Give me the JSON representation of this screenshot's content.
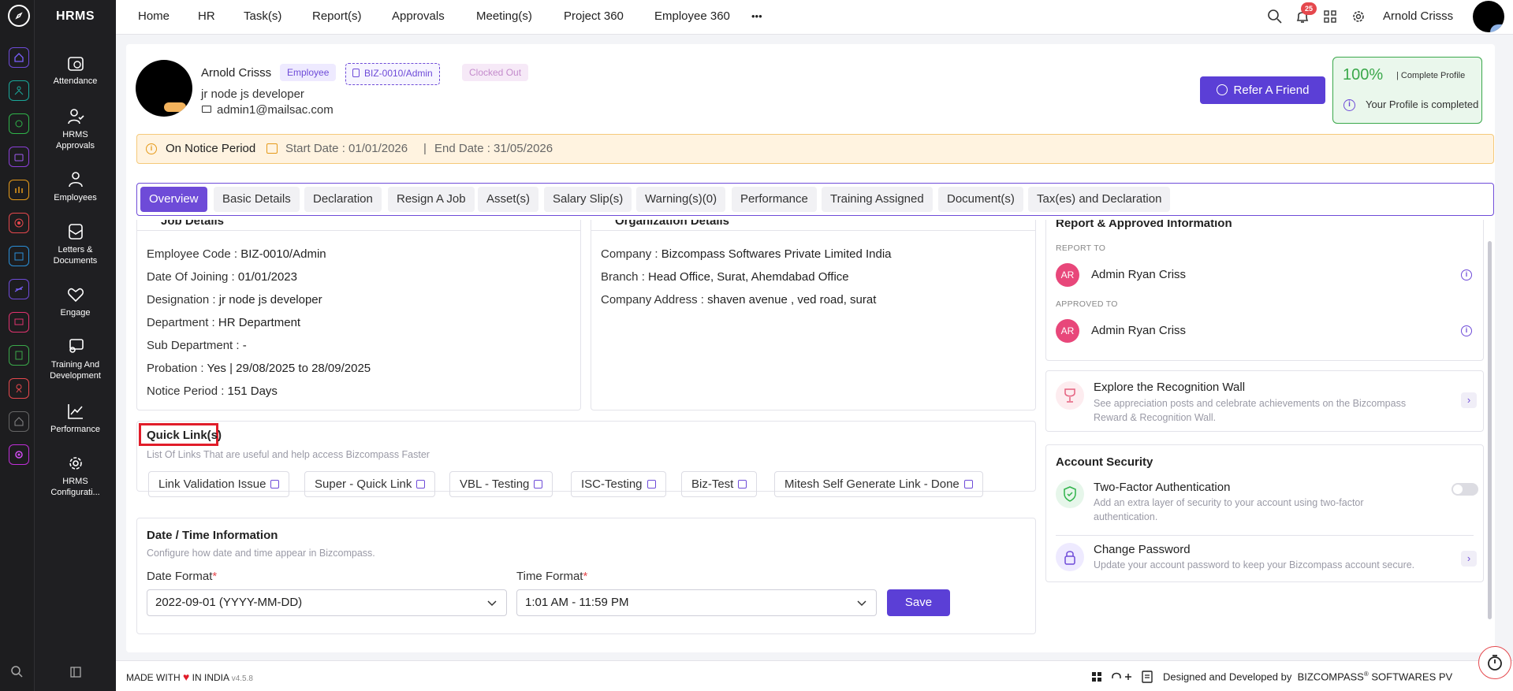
{
  "app": {
    "title": "HRMS"
  },
  "sidebar": {
    "items": [
      {
        "label": "Attendance",
        "icon": "attendance-icon"
      },
      {
        "label": "HRMS Approvals",
        "icon": "approvals-icon"
      },
      {
        "label": "Employees",
        "icon": "employees-icon"
      },
      {
        "label": "Letters & Documents",
        "icon": "letters-icon"
      },
      {
        "label": "Engage",
        "icon": "engage-icon"
      },
      {
        "label": "Training And Development",
        "icon": "training-icon"
      },
      {
        "label": "Performance",
        "icon": "performance-icon"
      },
      {
        "label": "HRMS Configurati...",
        "icon": "config-icon"
      }
    ]
  },
  "topnav": {
    "items": [
      "Home",
      "HR",
      "Task(s)",
      "Report(s)",
      "Approvals",
      "Meeting(s)",
      "Project 360",
      "Employee 360"
    ],
    "more": "•••",
    "notifications": "25",
    "user": "Arnold Crisss"
  },
  "profile": {
    "name": "Arnold Crisss",
    "role_badge": "Employee",
    "code_badge": "BIZ-0010/Admin",
    "status_badge": "Clocked Out",
    "designation": "jr node js developer",
    "email": "admin1@mailsac.com",
    "refer_label": "Refer A Friend",
    "complete_pct": "100%",
    "complete_label": "| Complete Profile",
    "complete_msg": "Your Profile is completed"
  },
  "notice": {
    "label": "On Notice Period",
    "start": "Start Date : 01/01/2026",
    "sep": "|",
    "end": "End Date : 31/05/2026"
  },
  "tabs": [
    "Overview",
    "Basic Details",
    "Declaration",
    "Resign A Job",
    "Asset(s)",
    "Salary Slip(s)",
    "Warning(s)(0)",
    "Performance",
    "Training Assigned",
    "Document(s)",
    "Tax(es) and Declaration"
  ],
  "job": {
    "title": "Job Details",
    "rows": [
      {
        "k": "Employee Code : ",
        "v": "BIZ-0010/Admin"
      },
      {
        "k": "Date Of Joining : ",
        "v": "01/01/2023"
      },
      {
        "k": "Designation : ",
        "v": "jr node js developer"
      },
      {
        "k": "Department : ",
        "v": "HR Department"
      },
      {
        "k": "Sub Department : ",
        "v": "-"
      },
      {
        "k": "Probation : ",
        "v": "Yes | 29/08/2025 to 28/09/2025"
      },
      {
        "k": "Notice Period : ",
        "v": "151 Days"
      }
    ]
  },
  "org": {
    "title": "Organization Details",
    "rows": [
      {
        "k": "Company : ",
        "v": "Bizcompass Softwares Private Limited India"
      },
      {
        "k": "Branch : ",
        "v": "Head Office, Surat, Ahemdabad Office"
      },
      {
        "k": "Company Address : ",
        "v": "shaven avenue , ved road, surat"
      }
    ]
  },
  "reporting": {
    "title": "Report & Approved Information",
    "report_to_label": "REPORT TO",
    "report_to": {
      "initials": "AR",
      "name": "Admin Ryan Criss"
    },
    "approved_to_label": "APPROVED TO",
    "approved_to": {
      "initials": "AR",
      "name": "Admin Ryan Criss"
    }
  },
  "recognition": {
    "title": "Explore the Recognition Wall",
    "desc1": "See appreciation posts and celebrate achievements on the Bizcompass",
    "desc2": "Reward & Recognition Wall."
  },
  "security": {
    "title": "Account Security",
    "twofa_title": "Two-Factor Authentication",
    "twofa_desc1": "Add an extra layer of security to your account using two-factor",
    "twofa_desc2": "authentication.",
    "twofa_enabled": false,
    "pwd_title": "Change Password",
    "pwd_desc": "Update your account password to keep your Bizcompass account secure."
  },
  "quicklinks": {
    "title": "Quick Link(s)",
    "subtitle": "List Of Links That are useful and help access Bizcompass Faster",
    "links": [
      "Link Validation Issue",
      "Super - Quick Link",
      "VBL - Testing",
      "ISC-Testing",
      "Biz-Test",
      "Mitesh Self Generate Link - Done"
    ]
  },
  "datetime": {
    "title": "Date / Time Information",
    "subtitle": "Configure how date and time appear in Bizcompass.",
    "date_label": "Date Format",
    "date_value": "2022-09-01 (YYYY-MM-DD)",
    "time_label": "Time Format",
    "time_value": "1:01 AM - 11:59 PM",
    "required": "*",
    "save_label": "Save"
  },
  "footer": {
    "made_prefix": "MADE WITH",
    "made_suffix": "IN INDIA",
    "version": "v4.5.8",
    "designed": "Designed and Developed by",
    "brand": "BIZCOMPASS",
    "brand_suffix": "SOFTWARES PV"
  },
  "colors": {
    "accent": "#6e4bd8",
    "success": "#3aa84a",
    "avatar": "#e8477a",
    "warning_bg": "#fff3e0"
  }
}
